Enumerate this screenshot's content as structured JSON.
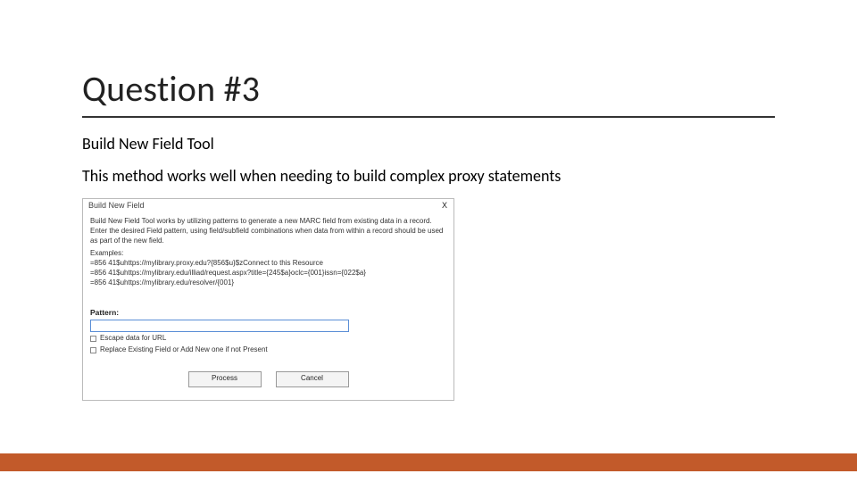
{
  "title": "Question #3",
  "subtitle": "Build New Field Tool",
  "description": "This method works well when needing to build complex proxy statements",
  "dialog": {
    "title": "Build New Field",
    "close": "X",
    "intro": "Build New Field Tool works by utilizing patterns to generate a new MARC field from existing data in a record. Enter the desired Field pattern, using field/subfield combinations when data from within a record should be used as part of the new field.",
    "examplesLabel": "Examples:",
    "ex1": "=856  41$uhttps://mylibrary.proxy.edu?{856$u}$zConnect to this Resource",
    "ex2": "=856  41$uhttps://mylibrary.edu/illiad/request.aspx?title={245$a}oclc={001}issn={022$a}",
    "ex3": "=856  41$uhttps://mylibrary.edu/resolver/{001}",
    "patternLabel": "Pattern:",
    "patternValue": "",
    "check1": "Escape data for URL",
    "check2": "Replace Existing Field or Add New one if not Present",
    "processBtn": "Process",
    "cancelBtn": "Cancel"
  },
  "colors": {
    "accent": "#c25a2a"
  }
}
